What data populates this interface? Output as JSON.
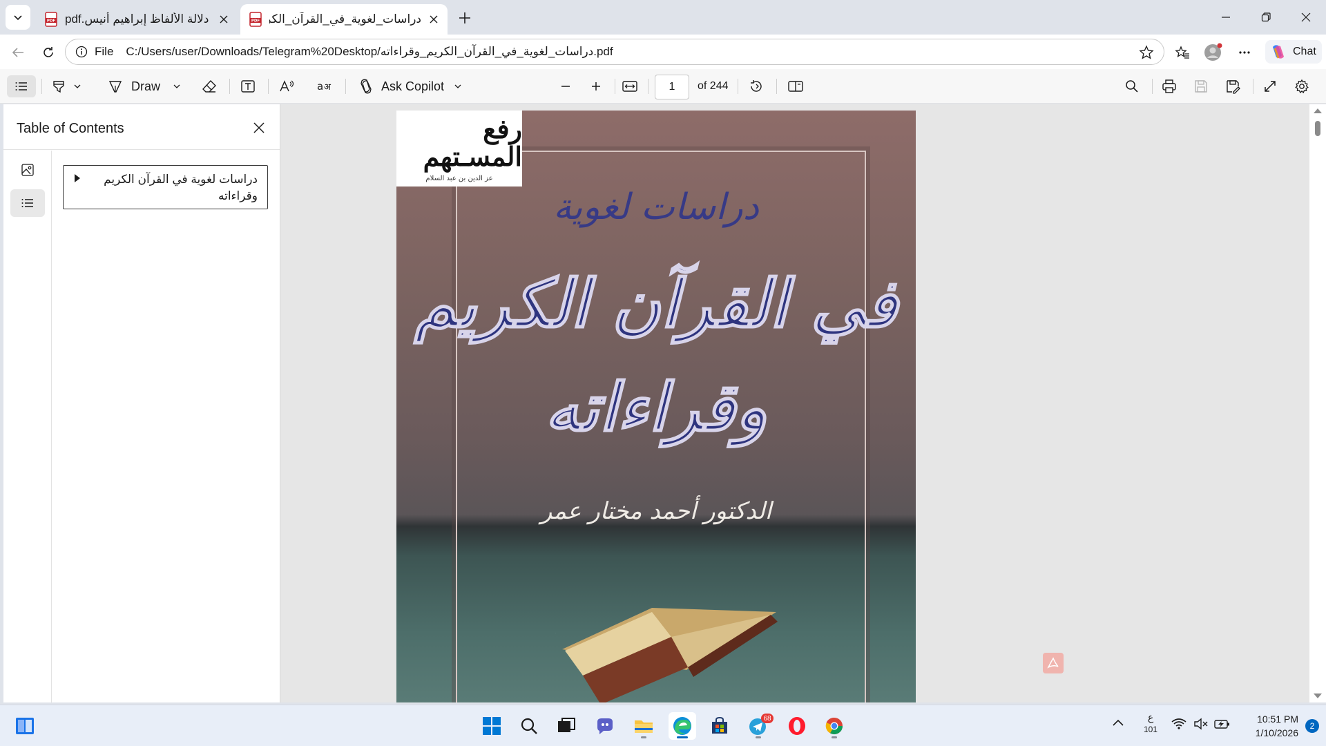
{
  "browser": {
    "tabs": [
      {
        "title": "دلالة الألفاظ إبراهيم أنيس.pdf",
        "active": false,
        "icon": "pdf-icon"
      },
      {
        "title": "دراسات_لغوية_في_القرآن_الكريم_وقراءاته.pdf",
        "active": true,
        "icon": "pdf-icon"
      }
    ],
    "address": {
      "scheme_label": "File",
      "url": "C:/Users/user/Downloads/Telegram%20Desktop/دراسات_لغوية_في_القرآن_الكريم_وقراءاته.pdf"
    },
    "chat_label": "Chat"
  },
  "pdf_toolbar": {
    "draw_label": "Draw",
    "copilot_label": "Ask Copilot",
    "page_current": "1",
    "page_total": "of 244"
  },
  "toc": {
    "title": "Table of Contents",
    "items": [
      {
        "label": "دراسات لغوية في القرآن الكريم وقراءاته"
      }
    ]
  },
  "document": {
    "stamp_title": "رفع المسـتهم",
    "stamp_subtitle": "عز الدين بن عبد السلام",
    "cover_heading": "دراسات لغوية",
    "cover_title": "في القرآن الكريم وقراءاته",
    "cover_author": "الدكتور أحمد مختار عمر"
  },
  "taskbar": {
    "apps": [
      "start-icon",
      "search-icon",
      "task-view-icon",
      "teams-icon",
      "file-explorer-icon",
      "edge-icon",
      "store-icon",
      "telegram-icon",
      "opera-icon",
      "chrome-icon"
    ],
    "telegram_badge": "68",
    "ime_indicator": "ع",
    "ime_sub": "101",
    "time": "10:51 PM",
    "date": "1/10/2026",
    "notification_count": "2"
  },
  "colors": {
    "accent": "#0067c0",
    "cover_title_ink": "#2e347f",
    "tab_strip": "#dfe3ea"
  }
}
